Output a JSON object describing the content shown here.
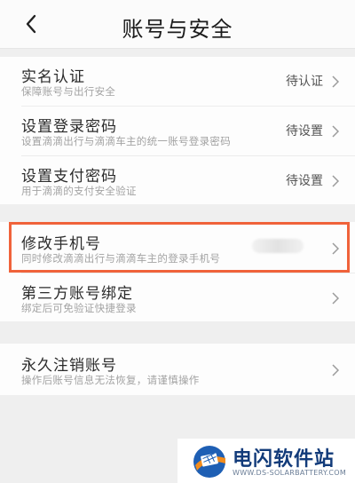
{
  "header": {
    "title": "账号与安全",
    "back_icon": "chevron-left-icon"
  },
  "groups": [
    [
      {
        "title": "实名认证",
        "subtitle": "保障账号与出行安全",
        "status": "待认证"
      },
      {
        "title": "设置登录密码",
        "subtitle": "设置滴滴出行与滴滴车主的统一账号登录密码",
        "status": "待设置"
      },
      {
        "title": "设置支付密码",
        "subtitle": "用于滴滴的支付安全验证",
        "status": "待设置"
      }
    ],
    [
      {
        "title": "修改手机号",
        "subtitle": "同时修改滴滴出行与滴滴车主的登录手机号",
        "status": ""
      },
      {
        "title": "第三方账号绑定",
        "subtitle": "绑定后可免验证快捷登录",
        "status": ""
      }
    ],
    [
      {
        "title": "永久注销账号",
        "subtitle": "操作后账号信息无法恢复，请谨慎操作",
        "status": ""
      }
    ]
  ],
  "highlight_color": "#f0623a",
  "watermark": {
    "name": "电闪软件站",
    "url": "WWW.DS-SOLARBATTERY.COM"
  }
}
